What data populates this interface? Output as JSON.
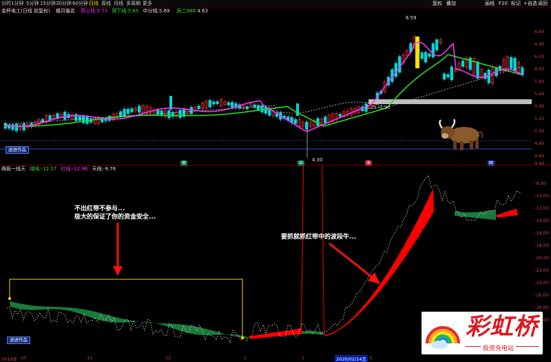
{
  "toolbar": {
    "periods": [
      "分时",
      "1分钟",
      "5分钟",
      "15分钟",
      "30分钟",
      "60分钟",
      "日线",
      "周线",
      "月线",
      "多周期",
      "更多"
    ],
    "selected": "日线",
    "right_tools": [
      "复权",
      "叠加",
      "画线",
      "F10",
      "标记",
      "+自选",
      "返回"
    ]
  },
  "price_header": {
    "stock": "金杯电工(日线 前复权)",
    "indicator": "蝶月循花",
    "upper_label": "预上线:",
    "upper_value": "5.73",
    "lower_label": "预下线:",
    "lower_value": "5.65",
    "mid_label": "中分线:",
    "mid_value": "5.69",
    "aux_label": "辰二",
    "aux_value": "886",
    "aux_value2": "4.63"
  },
  "price_axis": [
    "6.60",
    "6.40",
    "6.20",
    "6.00",
    "5.80",
    "5.60",
    "5.40",
    "5.20",
    "5.00",
    "4.80",
    "4.60",
    "4.40"
  ],
  "price_annotations": {
    "high": "6.59",
    "low": "4.30",
    "range": "5.23→5.30"
  },
  "price_markers": [
    "卖",
    "买",
    "涨",
    "财"
  ],
  "indicator_header": {
    "name": "两板一线天",
    "green_label": "绿线:",
    "green_value": "-12.17",
    "red_label": "红线:",
    "red_value": "-12.96",
    "sky_label": "天线:",
    "sky_value": "-9.76"
  },
  "indicator_axis": [
    "-8.00",
    "-10.00",
    "-12.00",
    "-14.00",
    "-16.00",
    "-18.00",
    "-20.00",
    "-22.00",
    "-24.00",
    "-26.00",
    "-28.00",
    "-30.00"
  ],
  "annotations": {
    "left_line1": "不出红带不参与...",
    "left_line2": "极大的保证了你的资金安全...",
    "right_line1": "要抓就抓红带中的波段牛..."
  },
  "badge_label": "送进作品",
  "logo": {
    "title": "彩虹桥",
    "subtitle": "投资充电站"
  },
  "date_axis": {
    "labels": [
      "2019年",
      "10",
      "11",
      "12",
      "1",
      "2",
      "3"
    ],
    "current": "2020/02/14五"
  },
  "colors": {
    "background": "#000000",
    "up_candle": "#ff3030",
    "down_candle": "#00e0e0",
    "magenta_line": "#ff30ff",
    "green_line": "#20e020",
    "red_band": "#ff0000",
    "green_band": "#1a7a3a",
    "grid": "#5a0000"
  },
  "icons": {
    "bull": "bull-icon",
    "rainbow": "rainbow-icon"
  }
}
